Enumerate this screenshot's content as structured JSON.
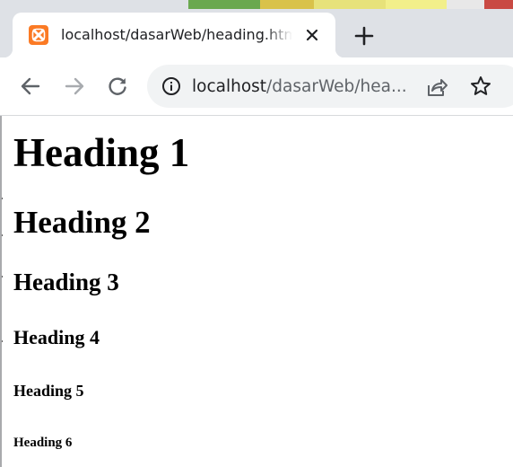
{
  "browser": {
    "tab": {
      "title": "localhost/dasarWeb/heading.html",
      "favicon": "xampp-icon",
      "close_icon": "close-icon"
    },
    "new_tab_icon": "plus-icon",
    "toolbar": {
      "back_icon": "arrow-left-icon",
      "forward_icon": "arrow-right-icon",
      "reload_icon": "reload-icon",
      "site_info_icon": "info-icon",
      "share_icon": "share-icon",
      "bookmark_icon": "star-icon"
    },
    "address_bar": {
      "host": "localhost",
      "path": "/dasarWeb/hea..."
    },
    "colors": {
      "tabstrip_bg": "#dee1e6",
      "omnibox_bg": "#f1f3f4",
      "favicon_bg": "#fb7a24",
      "icon_color": "#5f6368"
    }
  },
  "page": {
    "headings": {
      "h1": "Heading 1",
      "h2": "Heading 2",
      "h3": "Heading 3",
      "h4": "Heading 4",
      "h5": "Heading 5",
      "h6": "Heading 6"
    }
  }
}
